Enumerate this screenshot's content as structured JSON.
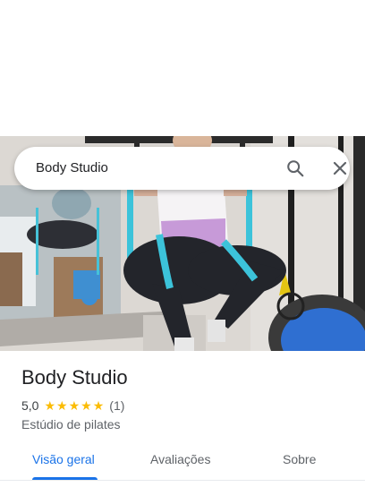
{
  "search": {
    "query": "Body Studio",
    "search_icon": "search-icon",
    "close_icon": "close-icon"
  },
  "photo": {
    "subject": "business-photo"
  },
  "place": {
    "title": "Body Studio",
    "rating": "5,0",
    "stars": 5,
    "review_count": "(1)",
    "category": "Estúdio de pilates"
  },
  "tabs": [
    {
      "label": "Visão geral",
      "active": true
    },
    {
      "label": "Avaliações",
      "active": false
    },
    {
      "label": "Sobre",
      "active": false
    }
  ],
  "colors": {
    "accent": "#1a73e8",
    "star": "#fbbc04",
    "text_primary": "#202124",
    "text_secondary": "#5f6368"
  }
}
